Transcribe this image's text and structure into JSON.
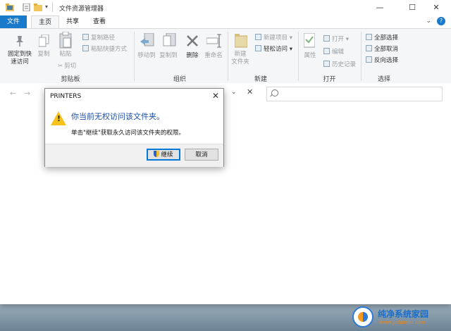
{
  "window": {
    "title": "文件资源管理器",
    "controls": {
      "minimize": "—",
      "maximize": "☐",
      "close": "✕"
    }
  },
  "tabs": [
    {
      "label": "文件"
    },
    {
      "label": "主页"
    },
    {
      "label": "共享"
    },
    {
      "label": "查看"
    }
  ],
  "ribbon": {
    "clipboard": {
      "pin_label_1": "固定到快",
      "pin_label_2": "速访问",
      "copy_label": "复制",
      "paste_label": "粘贴",
      "copy_path_label": "复制路径",
      "paste_shortcut_label": "粘贴快捷方式",
      "cut_label": "剪切",
      "group_label": "剪贴板"
    },
    "organize": {
      "move_to_label": "移动到",
      "copy_to_label": "复制到",
      "delete_label": "删除",
      "rename_label": "重命名",
      "group_label": "组织"
    },
    "new": {
      "new_folder_label_1": "新建",
      "new_folder_label_2": "文件夹",
      "new_item_label": "新建项目",
      "easy_access_label": "轻松访问",
      "group_label": "新建"
    },
    "open": {
      "properties_label": "属性",
      "open_label": "打开",
      "edit_label": "编辑",
      "history_label": "历史记录",
      "group_label": "打开"
    },
    "select": {
      "select_all_label": "全部选择",
      "select_none_label": "全部取消",
      "invert_label": "反向选择",
      "group_label": "选择"
    }
  },
  "dialog": {
    "title": "PRINTERS",
    "heading": "你当前无权访问该文件夹。",
    "message": "单击\"继续\"获取永久访问该文件夹的权限。",
    "continue_label": "继续",
    "cancel_label": "取消"
  },
  "watermark": {
    "text": "纯净系统家园",
    "url": "www.yidaimei.com"
  },
  "colors": {
    "accent": "#1979ca",
    "dialog_heading": "#1f4fa8",
    "warning": "#f6c21c"
  }
}
